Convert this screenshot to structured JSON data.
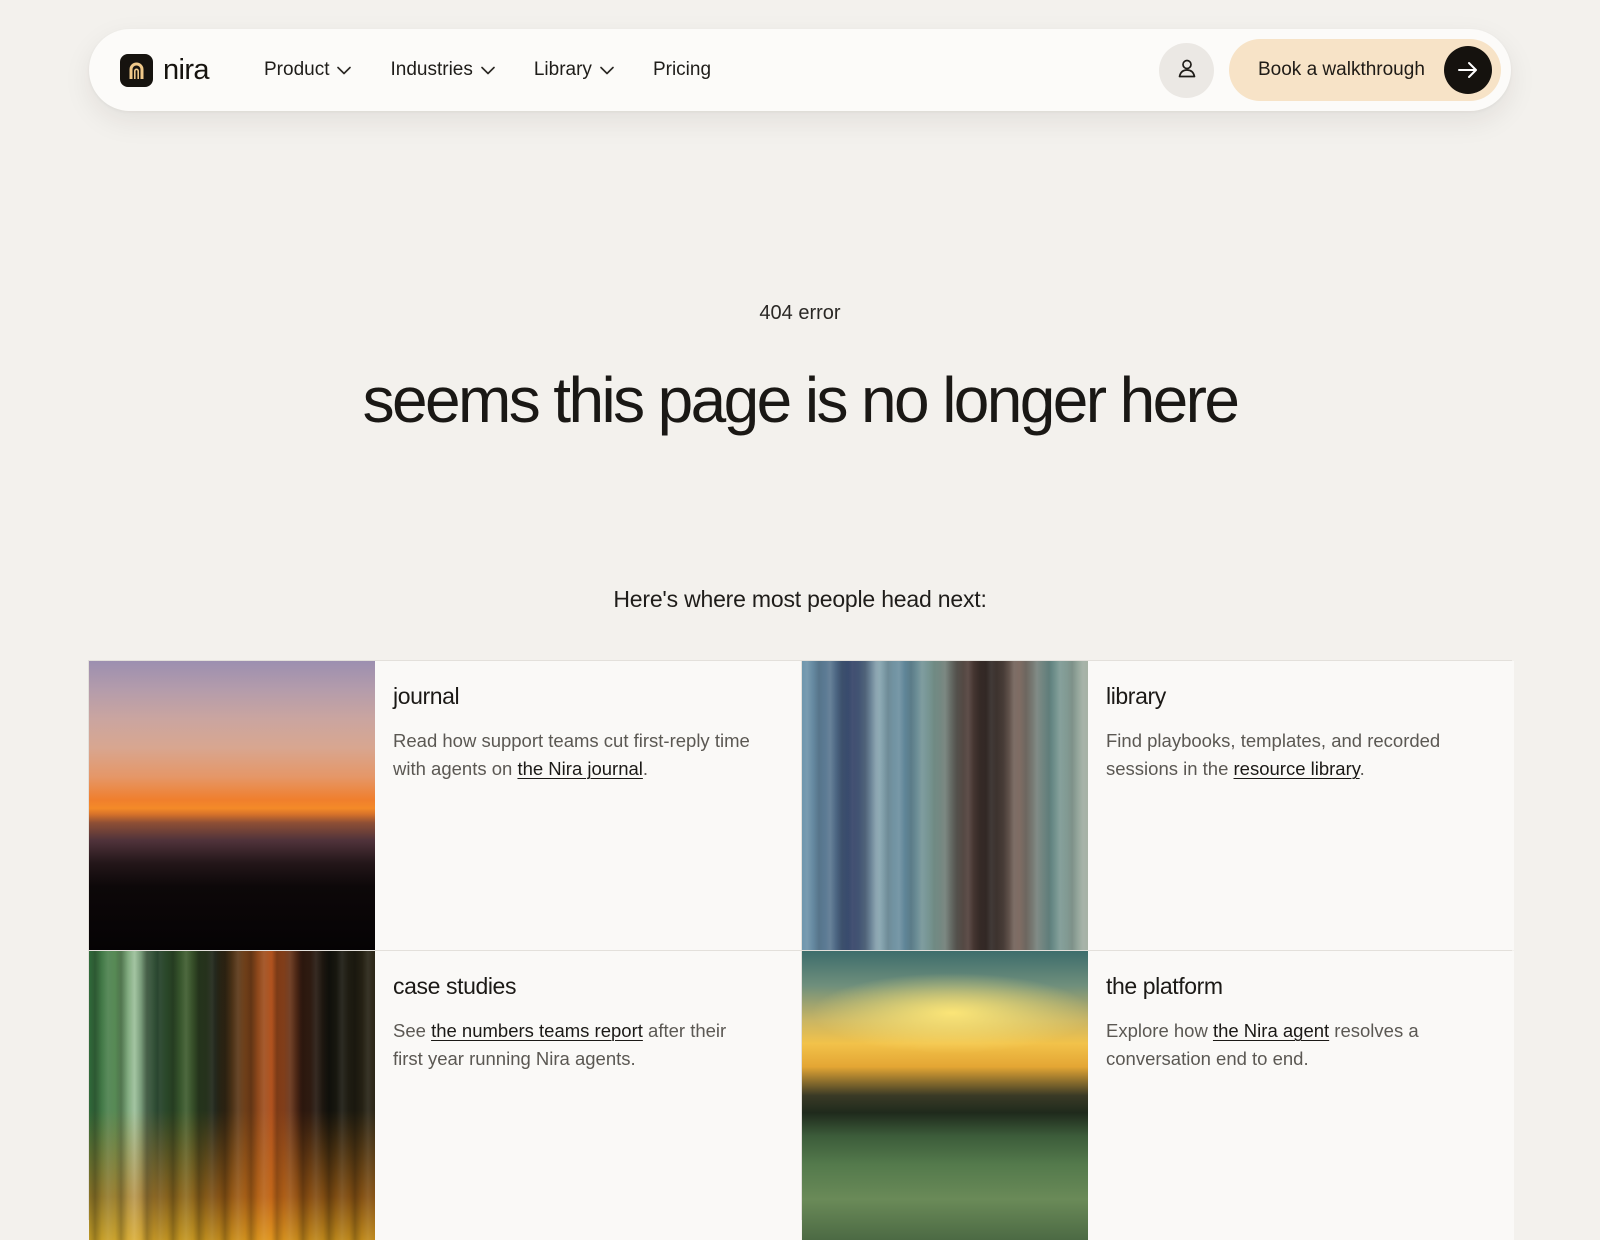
{
  "brand": {
    "name": "nira",
    "logo_icon": "arch-logo-icon"
  },
  "nav": {
    "items": [
      {
        "label": "Product",
        "has_dropdown": true
      },
      {
        "label": "Industries",
        "has_dropdown": true
      },
      {
        "label": "Library",
        "has_dropdown": true
      },
      {
        "label": "Pricing",
        "has_dropdown": false
      }
    ],
    "account_icon": "user-icon",
    "cta": {
      "label": "Book a walkthrough",
      "icon": "arrow-right-icon"
    }
  },
  "hero": {
    "eyebrow": "404 error",
    "headline": "seems this page is no longer here",
    "subhead": "Here's where most people head next:"
  },
  "cards": [
    {
      "title": "journal",
      "text_before": "Read how support teams cut first-reply time with agents on ",
      "link": "the Nira journal",
      "text_after": "."
    },
    {
      "title": "library",
      "text_before": "Find playbooks, templates, and recorded sessions in the ",
      "link": "resource library",
      "text_after": "."
    },
    {
      "title": "case studies",
      "text_before": "See ",
      "link": "the numbers teams report",
      "text_after": " after their first year running Nira agents."
    },
    {
      "title": "the platform",
      "text_before": "Explore how ",
      "link": "the Nira agent",
      "text_after": " resolves a conversation end to end."
    }
  ],
  "colors": {
    "page_bg": "#f3f1ed",
    "nav_bg": "#fcfbf9",
    "cta_bg": "#f7e3c7",
    "dark": "#15120e",
    "muted_text": "#5b5853"
  }
}
